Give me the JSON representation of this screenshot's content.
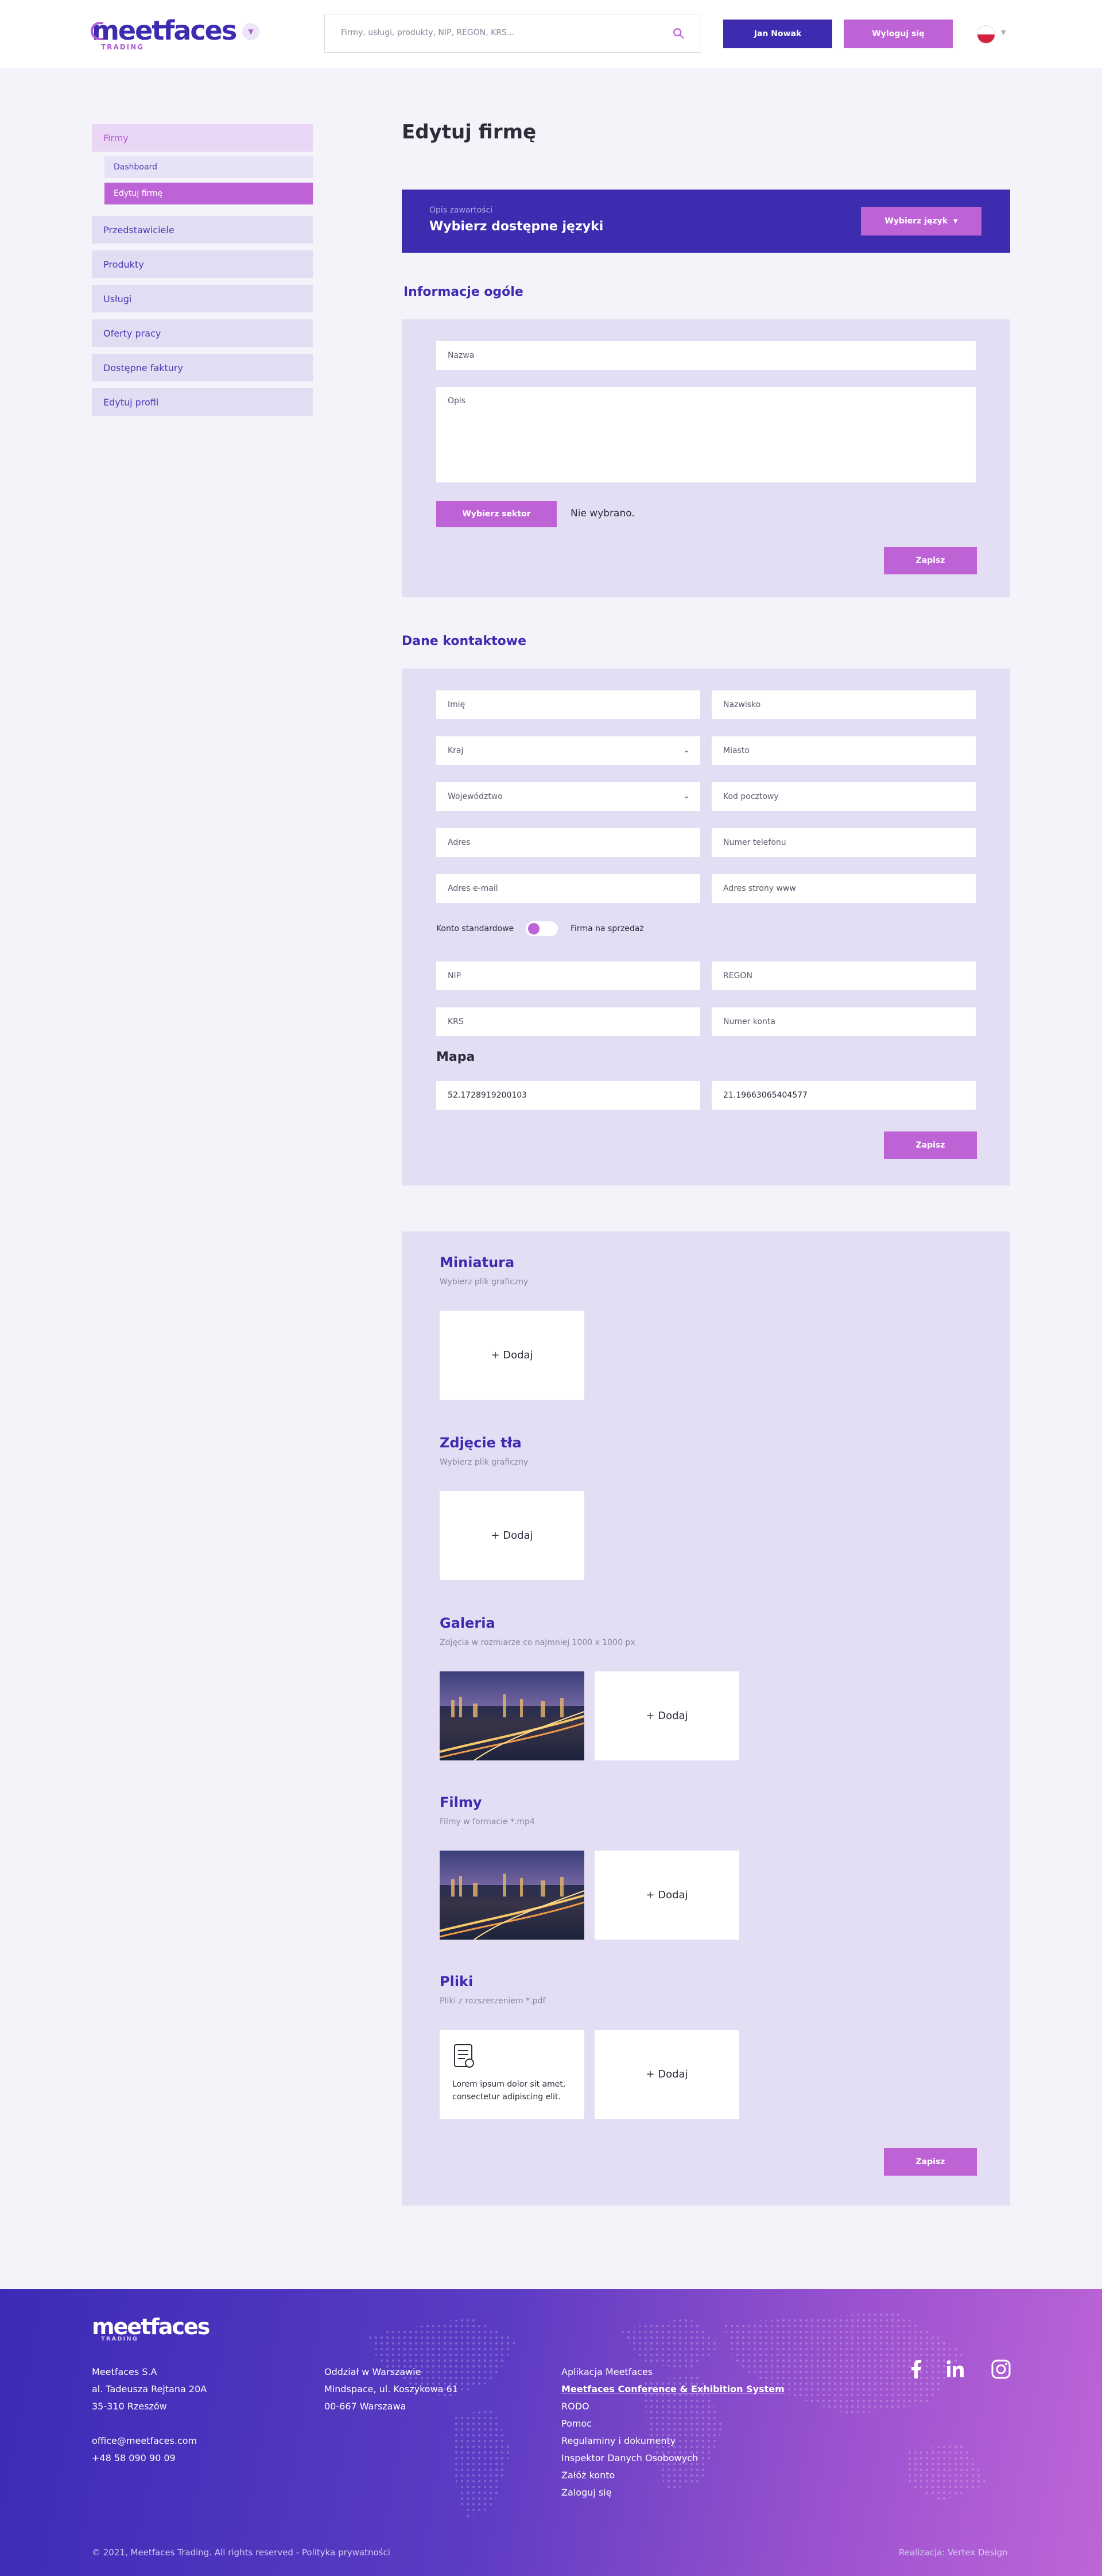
{
  "header": {
    "logo_text": "meetfaces",
    "logo_sub": "TRADING",
    "search_placeholder": "Firmy, usługi, produkty, NIP, REGON, KRS...",
    "user_button": "Jan Nowak",
    "logout_button": "Wyloguj się"
  },
  "sidebar": {
    "company": "Firmy",
    "dashboard": "Dashboard",
    "edit_company": "Edytuj firmę",
    "items": [
      "Przedstawiciele",
      "Produkty",
      "Usługi",
      "Oferty pracy",
      "Dostępne faktury",
      "Edytuj profil"
    ]
  },
  "main": {
    "title": "Edytuj firmę",
    "lang_label": "Opis zawartości",
    "lang_title": "Wybierz dostępne języki",
    "lang_button": "Wybierz język"
  },
  "general": {
    "title": "Informacje ogóle",
    "name_placeholder": "Nazwa",
    "desc_placeholder": "Opis",
    "sector_button": "Wybierz sektor",
    "sector_value": "Nie wybrano.",
    "save": "Zapisz"
  },
  "contact": {
    "title": "Dane kontaktowe",
    "first_name": "Imię",
    "last_name": "Nazwisko",
    "country": "Kraj",
    "city": "Miasto",
    "province": "Województwo",
    "postal": "Kod pocztowy",
    "address": "Adres",
    "phone": "Numer telefonu",
    "email": "Adres e-mail",
    "www": "Adres strony www",
    "toggle_left": "Konto standardowe",
    "toggle_right": "Firma na sprzedaż",
    "nip": "NIP",
    "regon": "REGON",
    "krs": "KRS",
    "account": "Numer konta",
    "map_title": "Mapa",
    "lat": "52.1728919200103",
    "lng": "21.19663065404577",
    "save": "Zapisz"
  },
  "media": {
    "thumb_title": "Miniatura",
    "thumb_hint": "Wybierz plik graficzny",
    "bg_title": "Zdjęcie tła",
    "bg_hint": "Wybierz plik graficzny",
    "gallery_title": "Galeria",
    "gallery_hint": "Zdjęcia w rozmiarze co najmniej 1000 x 1000 px",
    "films_title": "Filmy",
    "films_hint": "Filmy w formacie *.mp4",
    "files_title": "Pliki",
    "files_hint": "Pliki z rozszerzeniem *.pdf",
    "add": "+ Dodaj",
    "file_text": "Lorem ipsum dolor sit amet, consectetur adipiscing elit.",
    "save": "Zapisz"
  },
  "footer": {
    "logo_text": "meetfaces",
    "logo_sub": "TRADING",
    "col1": [
      "Meetfaces S.A",
      "al. Tadeusza Rejtana 20A",
      "35-310 Rzeszów"
    ],
    "email": "office@meetfaces.com",
    "phone": "+48  58 090 90 09",
    "col2": [
      "Oddział w Warszawie",
      "Mindspace, ul. Koszykowa 61",
      "00-667 Warszawa"
    ],
    "links": [
      "Aplikacja Meetfaces",
      "Meetfaces Conference & Exhibition System",
      "RODO",
      "Pomoc",
      "Regulaminy i dokumenty",
      "Inspektor Danych Osobowych",
      "Załóż konto",
      "Zaloguj się"
    ],
    "copyright": "© 2021, Meetfaces Trading. All rights reserved - Polityka prywatności",
    "credits": "Realizacja: Vertex Design"
  },
  "colors": {
    "primary": "#3d2bb0",
    "accent": "#bd63d6",
    "panel": "#e3def4",
    "background": "#f4f3f9"
  }
}
